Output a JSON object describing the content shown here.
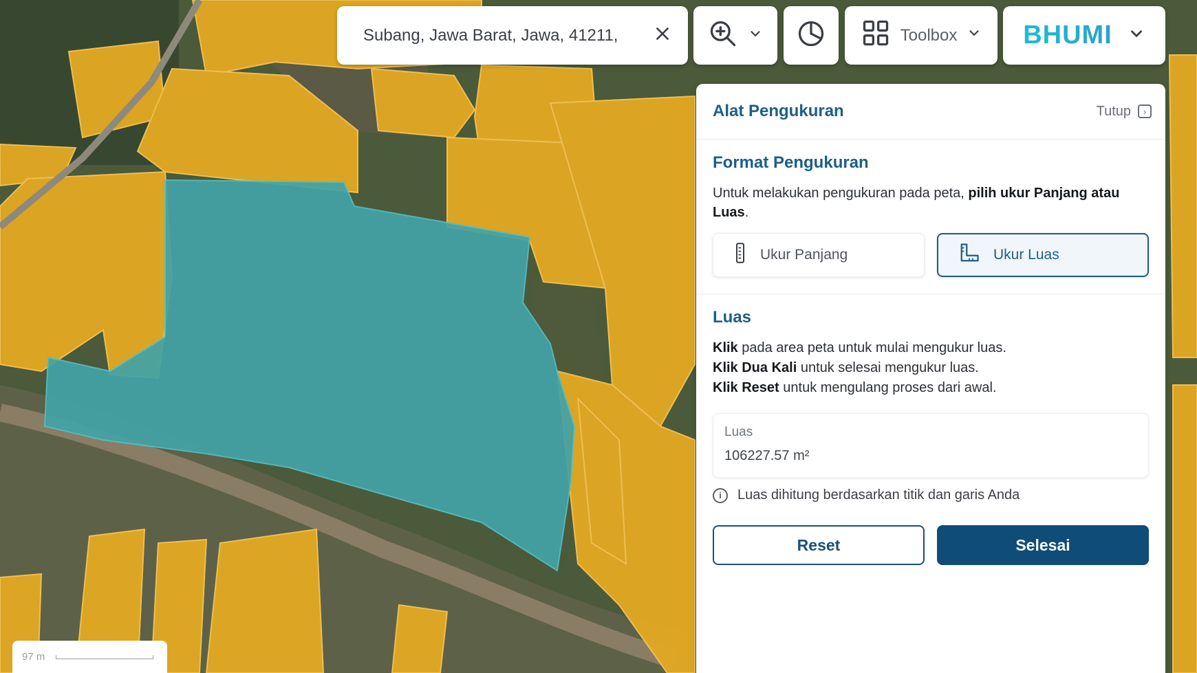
{
  "search": {
    "value": "Subang, Jawa Barat, Jawa, 41211,"
  },
  "toolbar": {
    "toolbox_label": "Toolbox",
    "brand": "BHUMI"
  },
  "panel": {
    "title": "Alat Pengukuran",
    "close_label": "Tutup",
    "format_title": "Format Pengukuran",
    "format_desc_prefix": "Untuk melakukan pengukuran pada peta, ",
    "format_desc_bold": "pilih ukur Panjang atau Luas",
    "format_desc_suffix": ".",
    "modes": [
      {
        "label": "Ukur Panjang",
        "icon": "ruler-icon",
        "active": false
      },
      {
        "label": "Ukur Luas",
        "icon": "area-icon",
        "active": true
      }
    ],
    "section_title": "Luas",
    "instructions": [
      {
        "bold": "Klik",
        "text": " pada area peta untuk mulai mengukur luas."
      },
      {
        "bold": "Klik Dua Kali",
        "text": " untuk selesai mengukur luas."
      },
      {
        "bold": "Klik Reset",
        "text": " untuk mengulang proses dari awal."
      }
    ],
    "result": {
      "label": "Luas",
      "value": "106227.57 m²"
    },
    "note": "Luas dihitung berdasarkan titik dan garis Anda",
    "reset_label": "Reset",
    "done_label": "Selesai"
  },
  "map": {
    "scale_label": "97 m",
    "colors": {
      "parcel": "#e2a823",
      "selection": "#43a3a6",
      "imagery": "#4b5a3a"
    }
  }
}
